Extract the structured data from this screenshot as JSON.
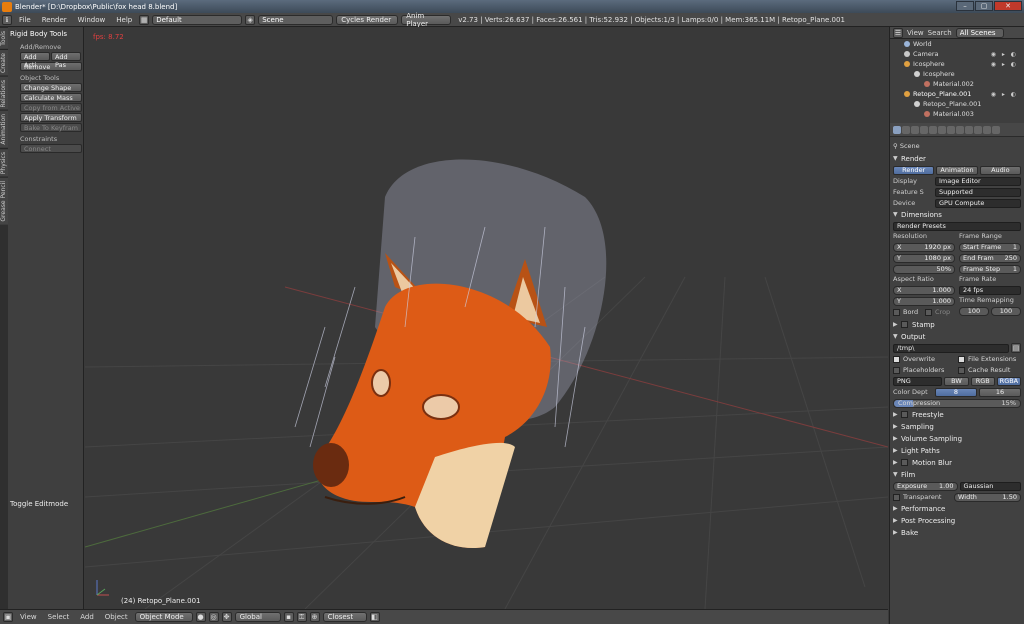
{
  "window": {
    "title": "Blender* [D:\\Dropbox\\Public\\fox head 8.blend]"
  },
  "info_header": {
    "menus": [
      "File",
      "Render",
      "Window",
      "Help"
    ],
    "screen_layout": "Default",
    "scene": "Scene",
    "render_engine": "Cycles Render",
    "anim_player": "Anim Player",
    "stats": "v2.73 | Verts:26.637 | Faces:26.561 | Tris:52.932 | Objects:1/3 | Lamps:0/0 | Mem:365.11M | Retopo_Plane.001"
  },
  "tool_tabs": [
    "Tools",
    "Create",
    "Relations",
    "Animation",
    "Physics",
    "Grease Pencil"
  ],
  "toolshelf": {
    "panel_title": "Rigid Body Tools",
    "add_remove_label": "Add/Remove",
    "add_active": "Add Acti",
    "add_passive": "Add Pas",
    "remove": "Remove",
    "object_tools_label": "Object Tools",
    "change_shape": "Change Shape",
    "calculate_mass": "Calculate Mass",
    "copy_from_active": "Copy from Active",
    "apply_transform": "Apply Transform",
    "bake_to_keyframes": "Bake To Keyfram",
    "constraints_label": "Constraints",
    "connect": "Connect",
    "toggle_editmode": "Toggle Editmode"
  },
  "viewport": {
    "fps": "fps: 8.72",
    "object_label": "(24) Retopo_Plane.001"
  },
  "bottom_header": {
    "menus": [
      "View",
      "Select",
      "Add",
      "Object"
    ],
    "mode": "Object Mode",
    "orientation": "Global",
    "snap": "Closest"
  },
  "outliner": {
    "tabs": [
      "View",
      "Search",
      "All Scenes"
    ],
    "items": [
      {
        "label": "World",
        "color": "#9ab4d8"
      },
      {
        "label": "Camera",
        "color": "#c8c8c8"
      },
      {
        "label": "Icosphere",
        "color": "#e0a040"
      },
      {
        "label": "Icosphere",
        "color": "#d0d0d0"
      },
      {
        "label": "Material.002",
        "color": "#c07060"
      },
      {
        "label": "Retopo_Plane.001",
        "color": "#e0a040"
      },
      {
        "label": "Retopo_Plane.001",
        "color": "#d0d0d0"
      },
      {
        "label": "Material.003",
        "color": "#c07060"
      }
    ]
  },
  "properties": {
    "breadcrumb": "Scene",
    "render_section": "Render",
    "render_btn": "Render",
    "animation_btn": "Animation",
    "audio_btn": "Audio",
    "display_label": "Display",
    "display_value": "Image Editor",
    "feature_label": "Feature S",
    "feature_value": "Supported",
    "device_label": "Device",
    "device_value": "GPU Compute",
    "dimensions_section": "Dimensions",
    "render_presets": "Render Presets",
    "resolution_label": "Resolution",
    "res_x_label": "X",
    "res_x": "1920 px",
    "res_y_label": "Y",
    "res_y": "1080 px",
    "res_pct": "50%",
    "frame_range_label": "Frame Range",
    "start_frame_label": "Start Frame",
    "start_frame": "1",
    "end_frame_label": "End Fram",
    "end_frame": "250",
    "frame_step_label": "Frame Step",
    "frame_step": "1",
    "aspect_label": "Aspect Ratio",
    "aspect_x": "1.000",
    "aspect_y": "1.000",
    "border_label": "Bord",
    "crop_label": "Crop",
    "frame_rate_label": "Frame Rate",
    "frame_rate": "24 fps",
    "time_remap_label": "Time Remapping",
    "remap_old": "100",
    "remap_new": "100",
    "stamp_section": "Stamp",
    "output_section": "Output",
    "output_path": "/tmp\\",
    "overwrite": "Overwrite",
    "file_extensions": "File Extensions",
    "placeholders": "Placeholders",
    "cache_result": "Cache Result",
    "format": "PNG",
    "bw": "BW",
    "rgb": "RGB",
    "rgba": "RGBA",
    "color_depth_label": "Color Dept",
    "depth_8": "8",
    "depth_16": "16",
    "compression_label": "Compression",
    "compression": "15%",
    "compression_fraction": 0.15,
    "freestyle_section": "Freestyle",
    "sampling_section": "Sampling",
    "volume_sampling_section": "Volume Sampling",
    "light_paths_section": "Light Paths",
    "motion_blur_section": "Motion Blur",
    "film_section": "Film",
    "exposure_label": "Exposure",
    "exposure": "1.00",
    "filter": "Gaussian",
    "transparent": "Transparent",
    "width_label": "Width",
    "width": "1.50",
    "performance_section": "Performance",
    "post_processing_section": "Post Processing",
    "bake_section": "Bake"
  }
}
